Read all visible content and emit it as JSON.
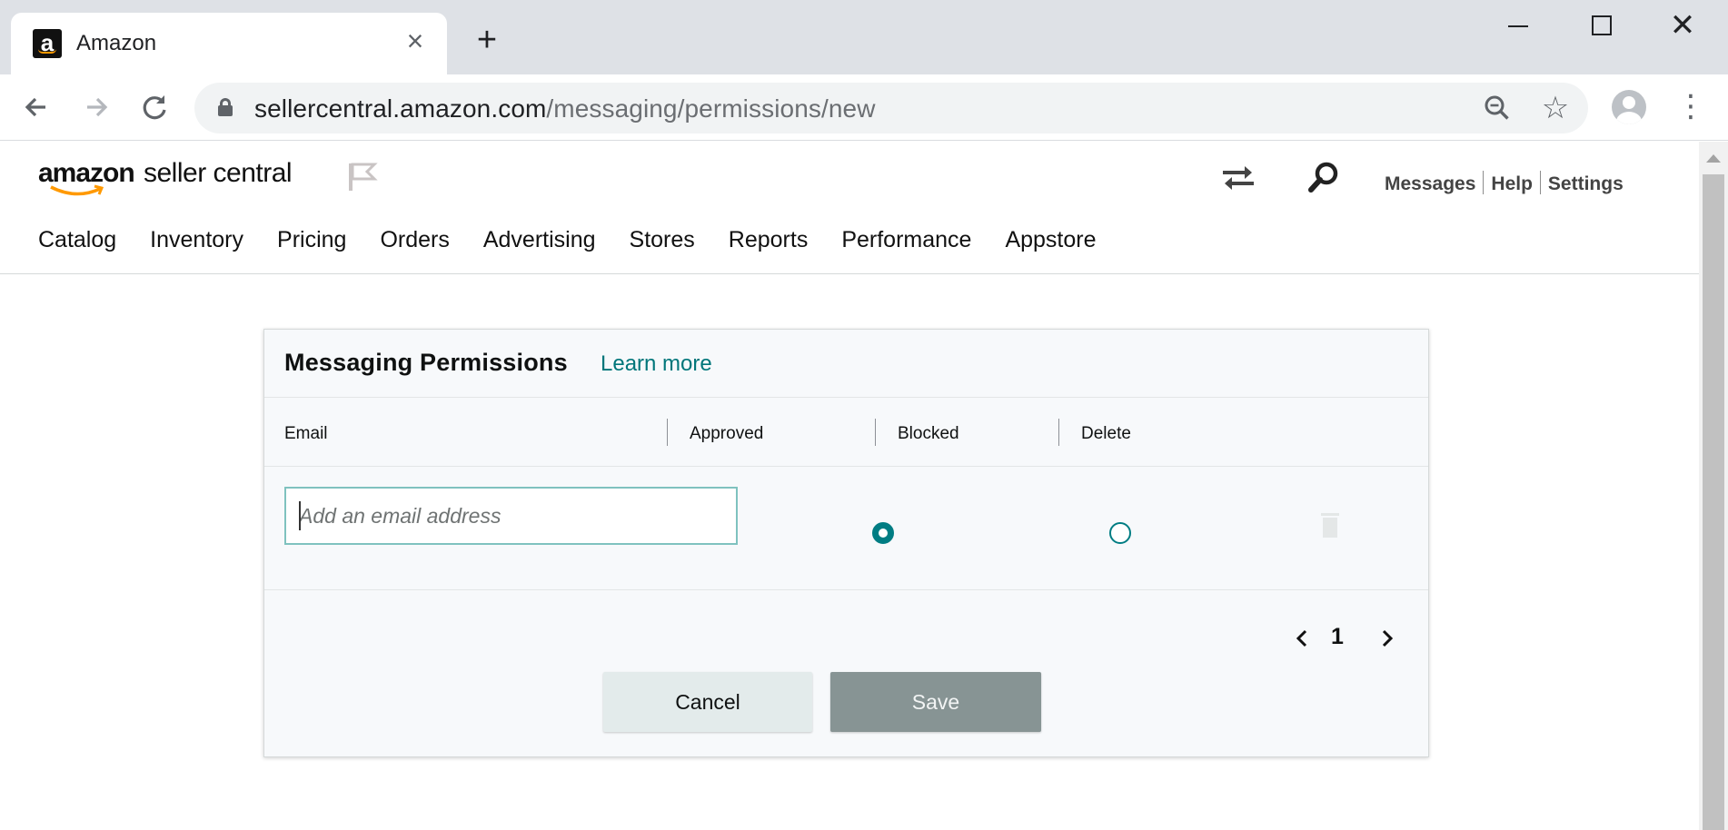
{
  "browser": {
    "tab_title": "Amazon",
    "favicon_letter": "a",
    "url_domain": "sellercentral.amazon.com",
    "url_path": "/messaging/permissions/new"
  },
  "header": {
    "logo_amazon": "amazon",
    "logo_product": "seller central",
    "links": [
      "Messages",
      "Help",
      "Settings"
    ]
  },
  "nav": [
    "Catalog",
    "Inventory",
    "Pricing",
    "Orders",
    "Advertising",
    "Stores",
    "Reports",
    "Performance",
    "Appstore"
  ],
  "panel": {
    "title": "Messaging Permissions",
    "learn_more": "Learn more",
    "columns": [
      "Email",
      "Approved",
      "Blocked",
      "Delete"
    ],
    "email_placeholder": "Add an email address",
    "email_value": "",
    "selected_permission": "Approved",
    "page": "1",
    "cancel_label": "Cancel",
    "save_label": "Save"
  },
  "colors": {
    "accent_teal": "#007d83",
    "link_teal": "#00767a",
    "save_bg": "#879494",
    "cancel_bg": "#e3ebeb"
  }
}
